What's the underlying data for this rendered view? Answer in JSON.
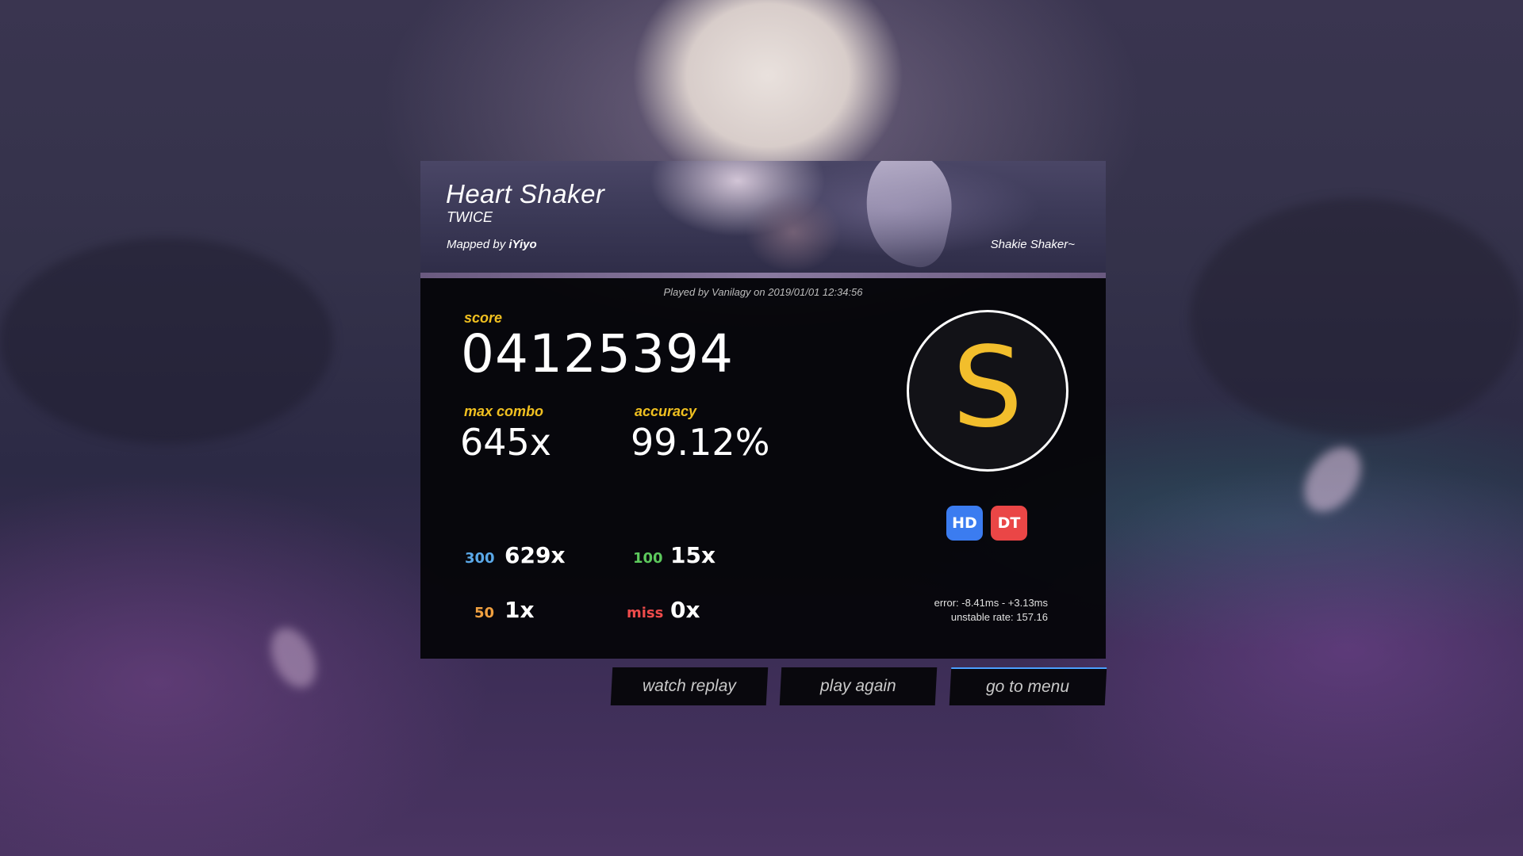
{
  "beatmap": {
    "title": "Heart Shaker",
    "artist": "TWICE",
    "mapped_by_prefix": "Mapped by",
    "mapper": "iYiyo",
    "difficulty": "Shakie Shaker~"
  },
  "played_by": "Played by Vanilagy on 2019/01/01 12:34:56",
  "score": {
    "label": "score",
    "value": "04125394"
  },
  "max_combo": {
    "label": "max combo",
    "value": "645x"
  },
  "accuracy": {
    "label": "accuracy",
    "value": "99.12%"
  },
  "rank": "S",
  "mods": [
    {
      "label": "HD",
      "color": "#3b7cf0"
    },
    {
      "label": "DT",
      "color": "#ea4646"
    }
  ],
  "hits": {
    "h300": {
      "label": "300",
      "value": "629x",
      "color": "#5aa8e8"
    },
    "h100": {
      "label": "100",
      "value": "15x",
      "color": "#5cc85c"
    },
    "h50": {
      "label": "50",
      "value": "1x",
      "color": "#f0a040"
    },
    "miss": {
      "label": "miss",
      "value": "0x",
      "color": "#ee4b4b"
    }
  },
  "error": "error: -8.41ms - +3.13ms",
  "unstable_rate": "unstable rate: 157.16",
  "buttons": {
    "watch_replay": "watch replay",
    "play_again": "play again",
    "go_to_menu": "go to menu"
  }
}
